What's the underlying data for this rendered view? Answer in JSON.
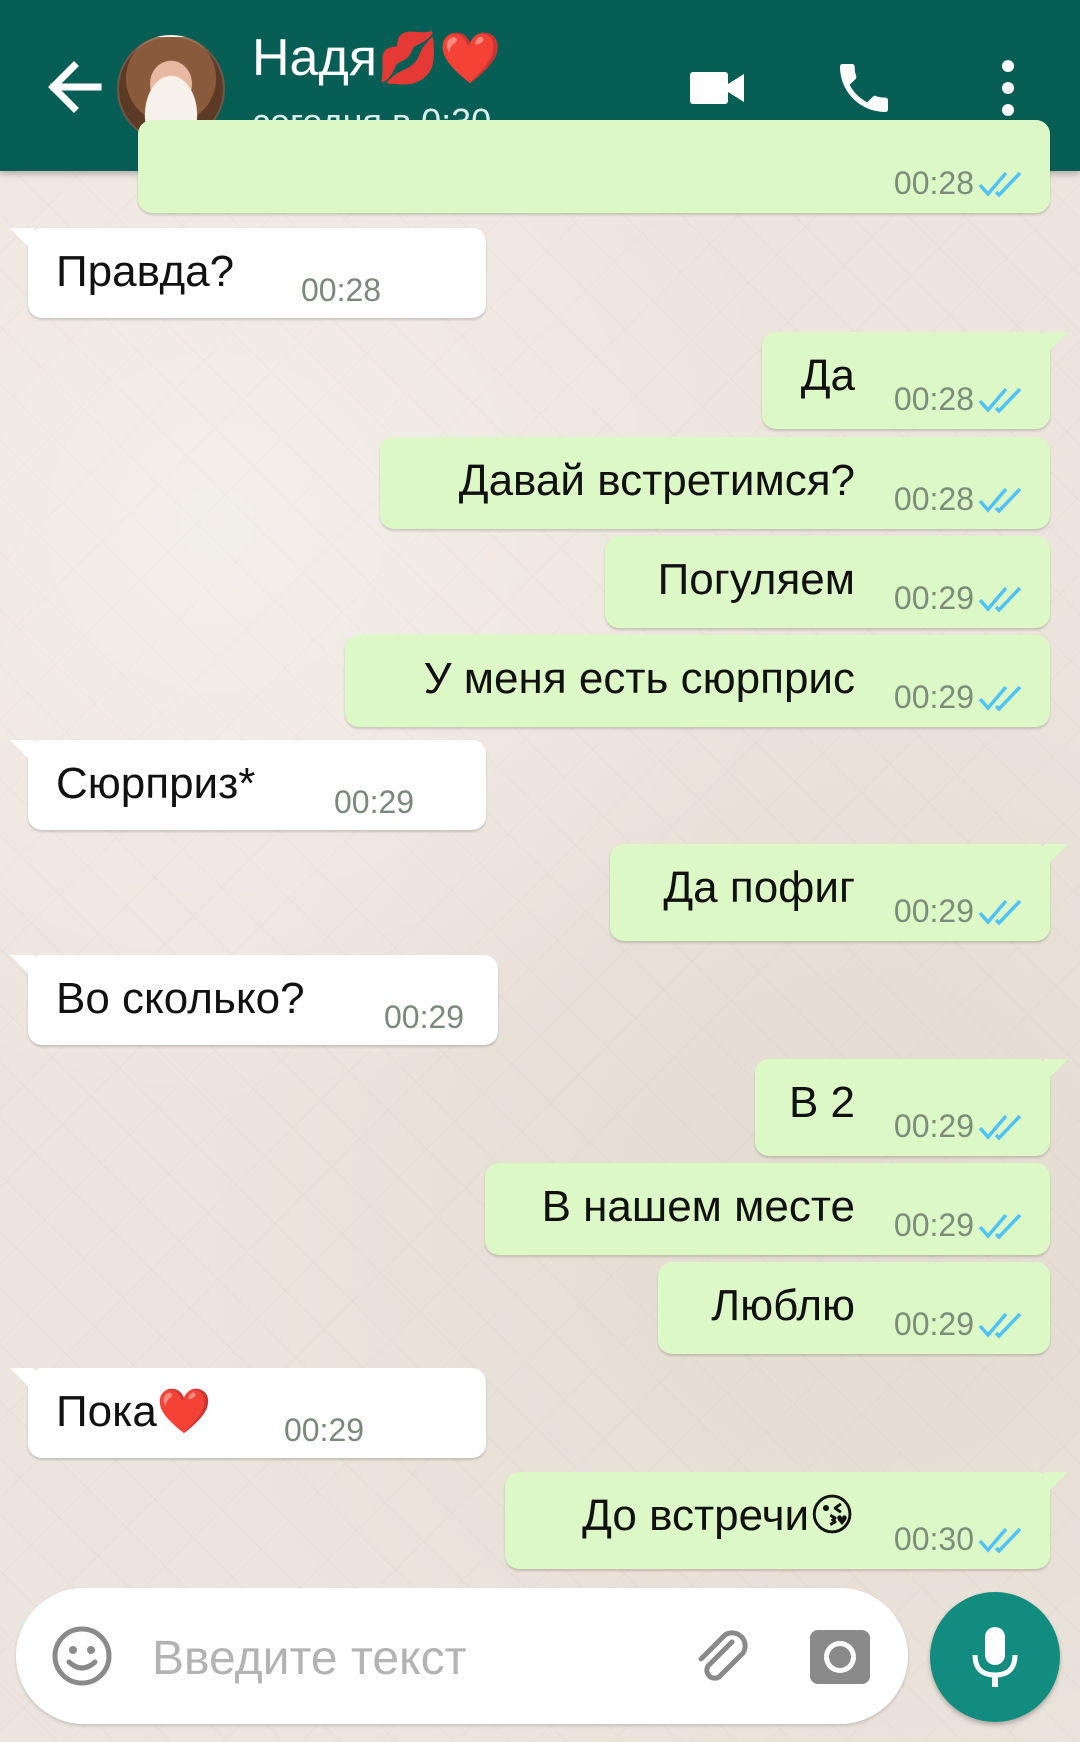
{
  "header": {
    "contact_name": "Надя",
    "name_emojis": "💋❤️",
    "status": "сегодня в 0:30",
    "icons": [
      "back-arrow-icon",
      "video-call-icon",
      "phone-icon",
      "more-vert-icon"
    ]
  },
  "messages": [
    {
      "dir": "out",
      "text": "",
      "time": "00:28",
      "ticks": "read",
      "partial": true
    },
    {
      "dir": "in",
      "text": "Правда?",
      "time": "00:28"
    },
    {
      "dir": "out",
      "text": "Да",
      "time": "00:28",
      "ticks": "read"
    },
    {
      "dir": "out",
      "text": "Давай встретимся?",
      "time": "00:28",
      "ticks": "read"
    },
    {
      "dir": "out",
      "text": "Погуляем",
      "time": "00:29",
      "ticks": "read"
    },
    {
      "dir": "out",
      "text": "У меня есть сюрприс",
      "time": "00:29",
      "ticks": "read"
    },
    {
      "dir": "in",
      "text": "Сюрприз*",
      "time": "00:29"
    },
    {
      "dir": "out",
      "text": "Да пофиг",
      "time": "00:29",
      "ticks": "read"
    },
    {
      "dir": "in",
      "text": "Во сколько?",
      "time": "00:29"
    },
    {
      "dir": "out",
      "text": "В 2",
      "time": "00:29",
      "ticks": "read"
    },
    {
      "dir": "out",
      "text": "В нашем месте",
      "time": "00:29",
      "ticks": "read"
    },
    {
      "dir": "out",
      "text": "Люблю",
      "time": "00:29",
      "ticks": "read"
    },
    {
      "dir": "in",
      "text": "Пока❤️",
      "time": "00:29"
    },
    {
      "dir": "out",
      "text": "До встречи😘",
      "time": "00:30",
      "ticks": "read"
    }
  ],
  "input": {
    "placeholder": "Введите текст",
    "icons": [
      "emoji-icon",
      "paperclip-icon",
      "camera-icon",
      "microphone-icon"
    ]
  },
  "colors": {
    "header": "#075e54",
    "outgoing_bubble": "#dcf8c6",
    "incoming_bubble": "#ffffff",
    "read_ticks": "#4fc3f7",
    "mic_button": "#128c7e",
    "background": "#ece5dd"
  }
}
